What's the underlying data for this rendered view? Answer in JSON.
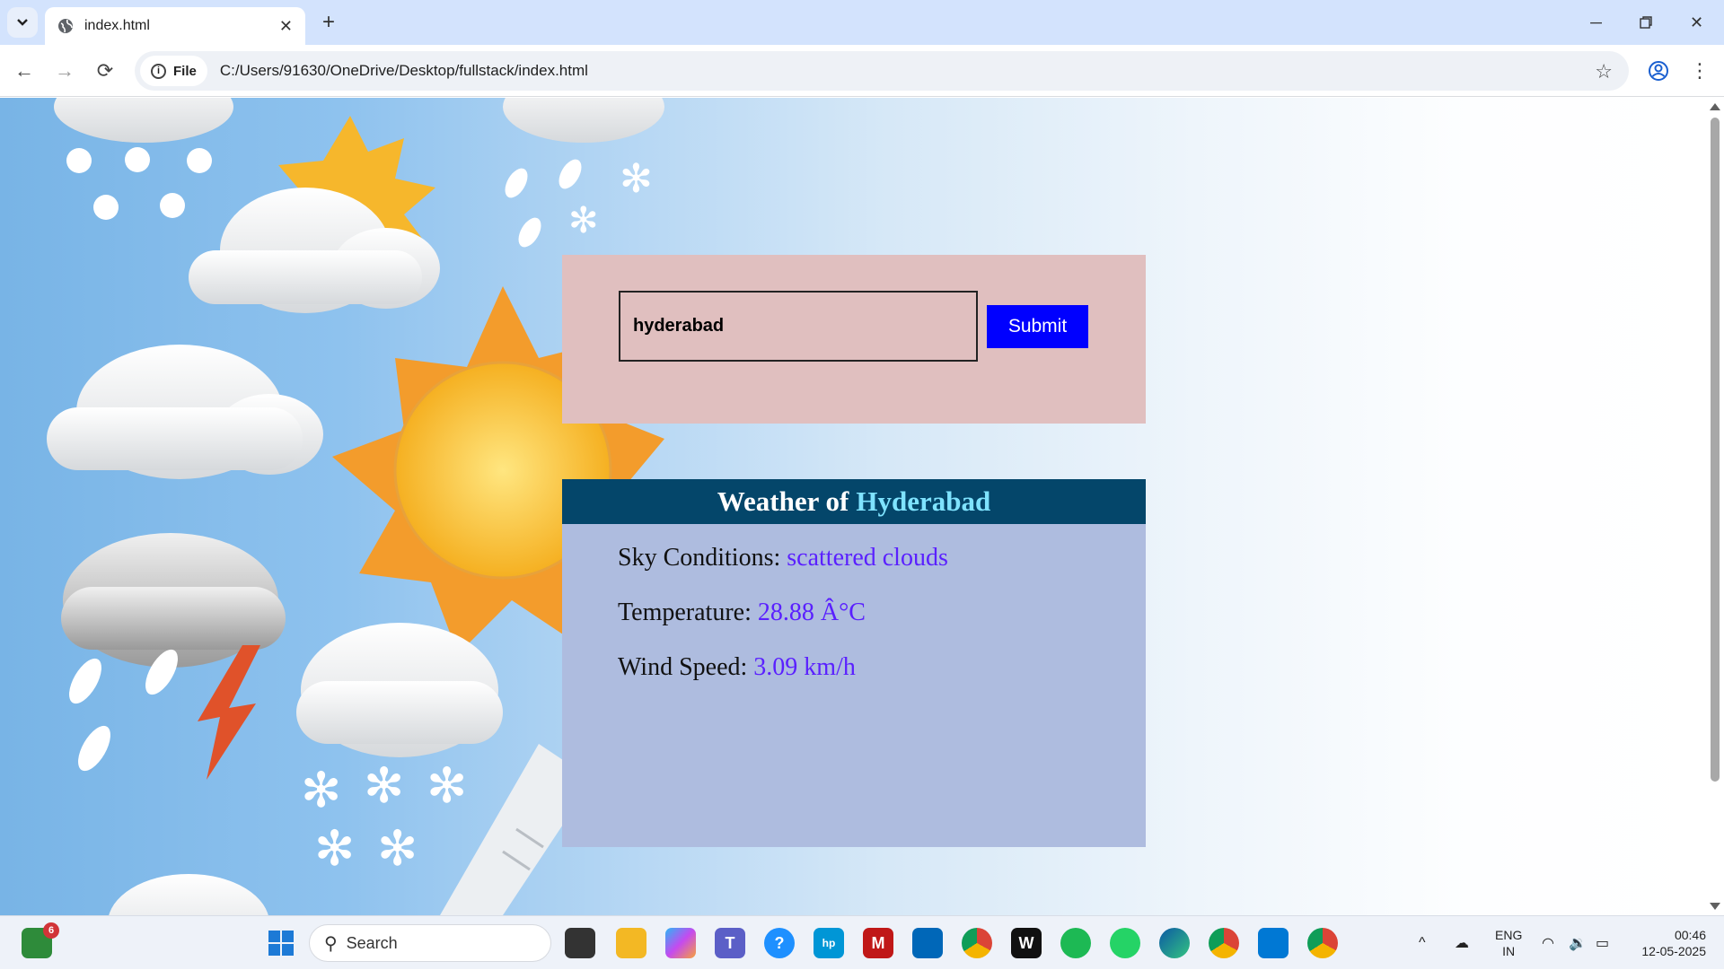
{
  "browser": {
    "tab_title": "index.html",
    "new_tab": "+",
    "url_chip": "File",
    "url": "C:/Users/91630/OneDrive/Desktop/fullstack/index.html"
  },
  "form": {
    "city_value": "hyderabad",
    "submit_label": "Submit"
  },
  "result": {
    "heading_prefix": "Weather of",
    "heading_city": "Hyderabad",
    "sky_label": "Sky Conditions:",
    "sky_value": "scattered clouds",
    "temp_label": "Temperature:",
    "temp_value": "28.88 Â°C",
    "wind_label": "Wind Speed:",
    "wind_value": "3.09 km/h"
  },
  "taskbar": {
    "search_placeholder": "Search",
    "badge_count": "6",
    "lang": "ENG",
    "region": "IN",
    "time": "00:46",
    "date": "12-05-2025"
  },
  "colors": {
    "form_bg": "#e0bfbf",
    "submit_bg": "#0000ff",
    "result_bg": "#aebcdf",
    "result_head": "#04466a",
    "value_text": "#5a20ff"
  }
}
